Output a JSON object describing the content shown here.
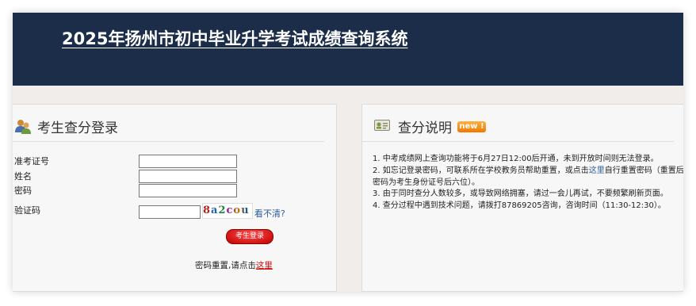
{
  "header": {
    "title": "2025年扬州市初中毕业升学考试成绩查询系统"
  },
  "login": {
    "title": "考生查分登录",
    "icon": "users-icon",
    "fields": {
      "exam_id_label": "准考证号",
      "name_label": "姓名",
      "password_label": "密码",
      "captcha_label": "验证码",
      "exam_id_value": "",
      "name_value": "",
      "password_value": "",
      "captcha_value": ""
    },
    "captcha_text": "8a2cou",
    "cant_see": "看不清?",
    "login_button": "考生登录",
    "reset_prefix": "密码重置,请点击",
    "reset_link": "这里"
  },
  "info": {
    "title": "查分说明",
    "icon": "id-card-icon",
    "badge": "new !",
    "notes": [
      {
        "text": "1. 中考成绩网上查询功能将于6月27日12:00后开通，未到开放时间则无法登录。"
      },
      {
        "prefix": "2. 如忘记登录密码，可联系所在学校教务员帮助重置，或点击",
        "link": "这里",
        "suffix": "自行重置密码（重置后密码为考生身份证号后六位）。"
      },
      {
        "text": "3. 由于同时查分人数较多，或导致网络拥塞，请过一会儿再试，不要频繁刷新页面。"
      },
      {
        "text": "4. 查分过程中遇到技术问题，请拨打87869205咨询，咨询时间（11:30-12:30）。"
      }
    ]
  },
  "colors": {
    "header_bg": "#1b2d48",
    "link": "#2a5c9a",
    "accent_red": "#d00000",
    "badge": "#f07800"
  }
}
